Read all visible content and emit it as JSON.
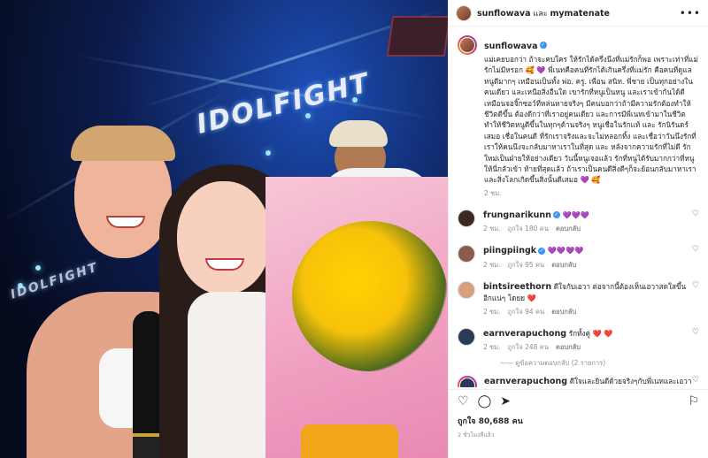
{
  "header": {
    "username": "sunflowava",
    "joiner": "และ",
    "collaborator": "mymatenate",
    "more_icon": "more-icon"
  },
  "caption": {
    "username": "sunflowava",
    "text": "แม่เคยบอกว่า ถ้าจะคบใคร ให้รักได้ครึ่งนึงที่แม่รักก็พอ เพราะเท่าที่แม่รักไม่มีหรอก 🥰 💜 พี่เนทคือคนที่รักได้เกินครึ่งที่แม่รัก คือคนที่ดูแลหนูดีมากๆ เหมือนเป็นทั้ง พ่อ. ครู. เพื่อน สนิท. พี่ชาย เป็นทุกอย่างในคนเดียว และเหนือสิ่งอื่นใด เขารักที่หนูเป็นหนู และเราเข้ากันได้ดีเหมือนจอจิ๊กซอว์ที่หล่นหายจริงๆ มีคนบอกว่าถ้ามีความรักต้องทำให้ชีวิตดีขึ้น ต้องดีกว่าที่เราอยู่คนเดียว และการมีพี่เนทเข้ามาในชีวิตทำให้ชีวิตหนูดีขึ้นในทุกๆด้านจริงๆ หนูเชื่อในรักแท้ และ รักนิรันดร์เสมอ เชื่อในคนดี ที่รักเราจริงและจะไม่หลอกทิ้ง และเชื่อว่าวันนึงรักที่เราให้คนนึงจะกลับมาหาเราในที่สุด และ หลังจากความรักที่ไม่ดี รักใหม่เป็นฝ่ายให้อย่างเดียว วันนี้หนูเจอแล้ว รักที่หนูได้รับมากกว่าที่หนูให้นี่กลัวเข้า ท้ายที่สุดแล้ว ถ้าเราเป็นคนดีสิ่งดีๆก็จะย้อนกลับมาหาเรา และสิ่งโลกเกิดขึ้นสิ่งนั้นดีเสมอ 💜 🥰",
    "time": "2 ชม."
  },
  "comments": [
    {
      "username": "frungnarikunn",
      "verified": true,
      "text": "💜💜💜",
      "time": "2 ชม.",
      "likes": "ถูกใจ 180 คน",
      "reply": "ตอบกลับ",
      "avatar_color": "#3a2a22"
    },
    {
      "username": "piingpiingk",
      "verified": true,
      "text": "💜💜💜💜",
      "time": "2 ชม.",
      "likes": "ถูกใจ 95 คน",
      "reply": "ตอบกลับ",
      "avatar_color": "#8a5c4a"
    },
    {
      "username": "bintsireethorn",
      "verified": false,
      "text": "ดีใจกับเอวา ต่อจากนี้ต้องเห็นเอวาสดใสขึ้นอีกแน่ๆ โดยย ❤️",
      "time": "2 ชม.",
      "likes": "ถูกใจ 94 คน",
      "reply": "ตอบกลับ",
      "avatar_color": "#d9a07e"
    },
    {
      "username": "earnverapuchong",
      "verified": false,
      "text": "รักทั้งคู่ ❤️ ❤️",
      "time": "2 ชม.",
      "likes": "ถูกใจ 248 คน",
      "reply": "ตอบกลับ",
      "avatar_color": "#2c3a5a"
    }
  ],
  "view_replies": "ดูข้อความตอบกลับ (2 รายการ)",
  "long_comment": {
    "username": "earnverapuchong",
    "text": "ดีใจและยินดีด้วยจริงๆกับพี่เนทและเอวาน้า 🖤 พี่เนทดูแลเอวาดีมากๆ และ เปลี่ยนตัวเองเพื่อเอวา ใช้วีดีความจริงใจและความรักจริงๆที่พี่เนทมีให้เอวา เอิร์นได้รับรู้และเห็นมาตั้งแต่วันแรกจนถึงวันนี้ ยินดีด้วยกับรักเป็นพี่ชายและคนในครอบครัวนะคะ ❤️ 💜"
  },
  "actions": {
    "like_icon": "heart-icon",
    "comment_icon": "comment-icon",
    "share_icon": "share-icon",
    "save_icon": "bookmark-icon"
  },
  "likes_text": "ถูกใจ 80,688 คน",
  "post_time": "2 ชั่วโมงที่แล้ว",
  "photo": {
    "arena_logo": "IDOLFIGHT",
    "side_logo": "IDOLFIGHT"
  }
}
